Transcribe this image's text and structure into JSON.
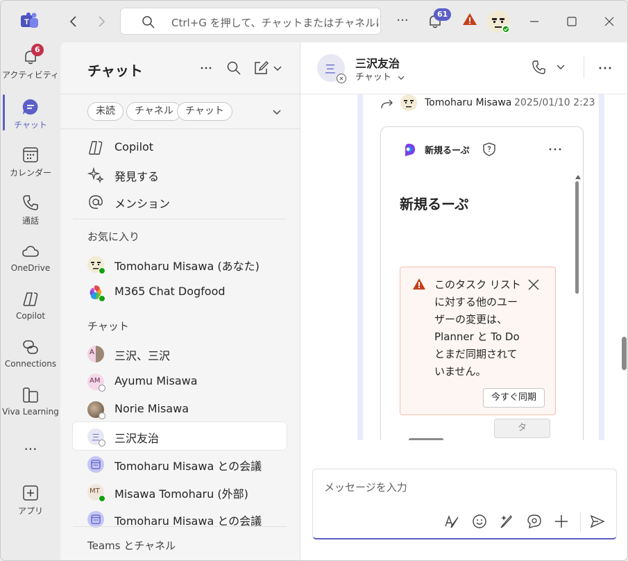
{
  "search": {
    "placeholder": "Ctrl+G を押して、チャットまたはチャネルに直接移動"
  },
  "titlebar": {
    "activity_badge": "61",
    "more": "···"
  },
  "rail": {
    "items": [
      {
        "label": "アクティビティ",
        "badge": "6"
      },
      {
        "label": "チャット"
      },
      {
        "label": "カレンダー"
      },
      {
        "label": "通話"
      },
      {
        "label": "OneDrive"
      },
      {
        "label": "Copilot"
      },
      {
        "label": "Connections"
      },
      {
        "label": "Viva Learning"
      },
      {
        "label": "···"
      },
      {
        "label": "アプリ"
      }
    ]
  },
  "panel": {
    "title": "チャット",
    "filters": [
      "未読",
      "チャネル",
      "チャット"
    ],
    "quick_items": [
      "Copilot",
      "発見する",
      "メンション"
    ],
    "favorites_label": "お気に入り",
    "favorites": [
      {
        "name": "Tomoharu Misawa (あなた)"
      },
      {
        "name": "M365 Chat Dogfood"
      }
    ],
    "chats_label": "チャット",
    "chats": [
      {
        "name": "三沢、三沢",
        "initials": "A"
      },
      {
        "name": "Ayumu Misawa",
        "initials": "AM"
      },
      {
        "name": "Norie Misawa"
      },
      {
        "name": "三沢友治",
        "initials": "三"
      },
      {
        "name": "Tomoharu Misawa との会議"
      },
      {
        "name": "Misawa Tomoharu  (外部)",
        "initials": "MT"
      },
      {
        "name": "Tomoharu Misawa との会議"
      }
    ],
    "teams_label": "Teams とチャネル"
  },
  "chat": {
    "name": "三沢友治",
    "sub": "チャット",
    "avatar_initial": "三",
    "message": {
      "sender": "Tomoharu Misawa",
      "timestamp": "2025/01/10 2:23",
      "card": {
        "app_name": "新規るーぷ",
        "title": "新規るーぷ",
        "warning": "このタスク リストに対する他のユーザーの変更は、Planner と To Do とまだ同期されていません。",
        "sync_button": "今すぐ同期",
        "partial_button": "タ"
      }
    },
    "compose_placeholder": "メッセージを入力"
  },
  "colors": {
    "accent": "#5b5fc7",
    "badge_red": "#c4314b",
    "warn_orange": "#c43e1c"
  }
}
